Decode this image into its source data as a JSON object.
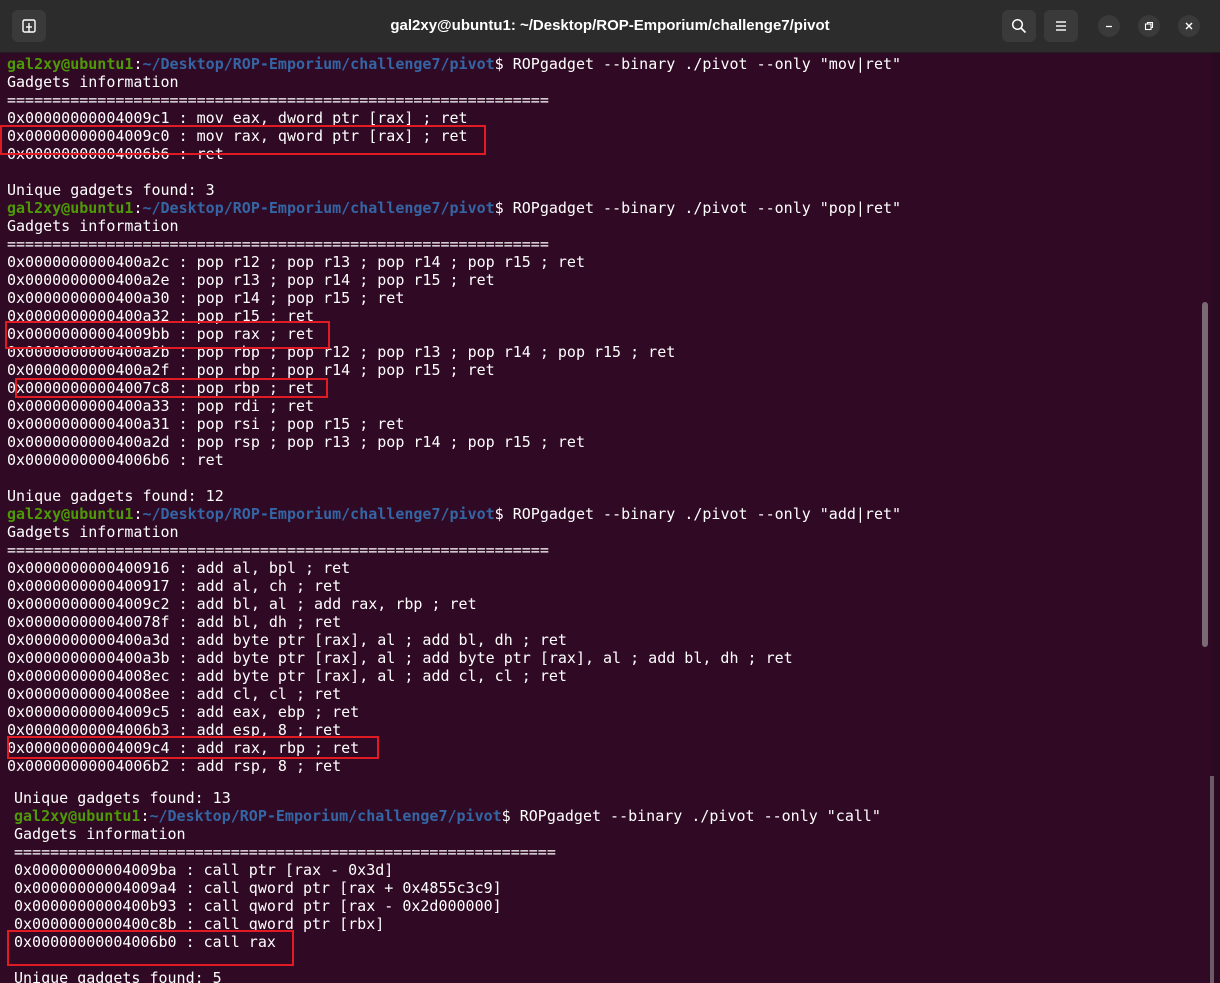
{
  "window": {
    "title": "gal2xy@ubuntu1: ~/Desktop/ROP-Emporium/challenge7/pivot",
    "new_tab_icon": "new-tab-icon",
    "search_icon": "search-icon",
    "menu_icon": "hamburger-menu-icon",
    "minimize_icon": "minimize-icon",
    "maximize_icon": "restore-icon",
    "close_icon": "close-icon"
  },
  "prompt": {
    "user": "gal2xy@ubuntu1",
    "sep": ":",
    "path": "~/Desktop/ROP-Emporium/challenge7/pivot",
    "dollar": "$"
  },
  "commands": [
    "ROPgadget --binary ./pivot --only \"mov|ret\"",
    "ROPgadget --binary ./pivot --only \"pop|ret\"",
    "ROPgadget --binary ./pivot --only \"add|ret\"",
    "ROPgadget --binary ./pivot --only \"call\""
  ],
  "header": "Gadgets information",
  "separator": "============================================================",
  "mov_gadgets": [
    "0x00000000004009c1 : mov eax, dword ptr [rax] ; ret",
    "0x00000000004009c0 : mov rax, qword ptr [rax] ; ret",
    "0x00000000004006b6 : ret"
  ],
  "mov_found": "Unique gadgets found: 3",
  "pop_gadgets": [
    "0x0000000000400a2c : pop r12 ; pop r13 ; pop r14 ; pop r15 ; ret",
    "0x0000000000400a2e : pop r13 ; pop r14 ; pop r15 ; ret",
    "0x0000000000400a30 : pop r14 ; pop r15 ; ret",
    "0x0000000000400a32 : pop r15 ; ret",
    "0x00000000004009bb : pop rax ; ret",
    "0x0000000000400a2b : pop rbp ; pop r12 ; pop r13 ; pop r14 ; pop r15 ; ret",
    "0x0000000000400a2f : pop rbp ; pop r14 ; pop r15 ; ret",
    "0x00000000004007c8 : pop rbp ; ret",
    "0x0000000000400a33 : pop rdi ; ret",
    "0x0000000000400a31 : pop rsi ; pop r15 ; ret",
    "0x0000000000400a2d : pop rsp ; pop r13 ; pop r14 ; pop r15 ; ret",
    "0x00000000004006b6 : ret"
  ],
  "pop_found": "Unique gadgets found: 12",
  "add_gadgets": [
    "0x0000000000400916 : add al, bpl ; ret",
    "0x0000000000400917 : add al, ch ; ret",
    "0x00000000004009c2 : add bl, al ; add rax, rbp ; ret",
    "0x000000000040078f : add bl, dh ; ret",
    "0x0000000000400a3d : add byte ptr [rax], al ; add bl, dh ; ret",
    "0x0000000000400a3b : add byte ptr [rax], al ; add byte ptr [rax], al ; add bl, dh ; ret",
    "0x00000000004008ec : add byte ptr [rax], al ; add cl, cl ; ret",
    "0x00000000004008ee : add cl, cl ; ret",
    "0x00000000004009c5 : add eax, ebp ; ret",
    "0x00000000004006b3 : add esp, 8 ; ret",
    "0x00000000004009c4 : add rax, rbp ; ret",
    "0x00000000004006b2 : add rsp, 8 ; ret"
  ],
  "add_found": "Unique gadgets found: 13",
  "call_gadgets": [
    "0x00000000004009ba : call ptr [rax - 0x3d]",
    "0x00000000004009a4 : call qword ptr [rax + 0x4855c3c9]",
    "0x0000000000400b93 : call qword ptr [rax - 0x2d000000]",
    "0x0000000000400c8b : call qword ptr [rbx]",
    "0x00000000004006b0 : call rax"
  ],
  "call_found": "Unique gadgets found: 5"
}
